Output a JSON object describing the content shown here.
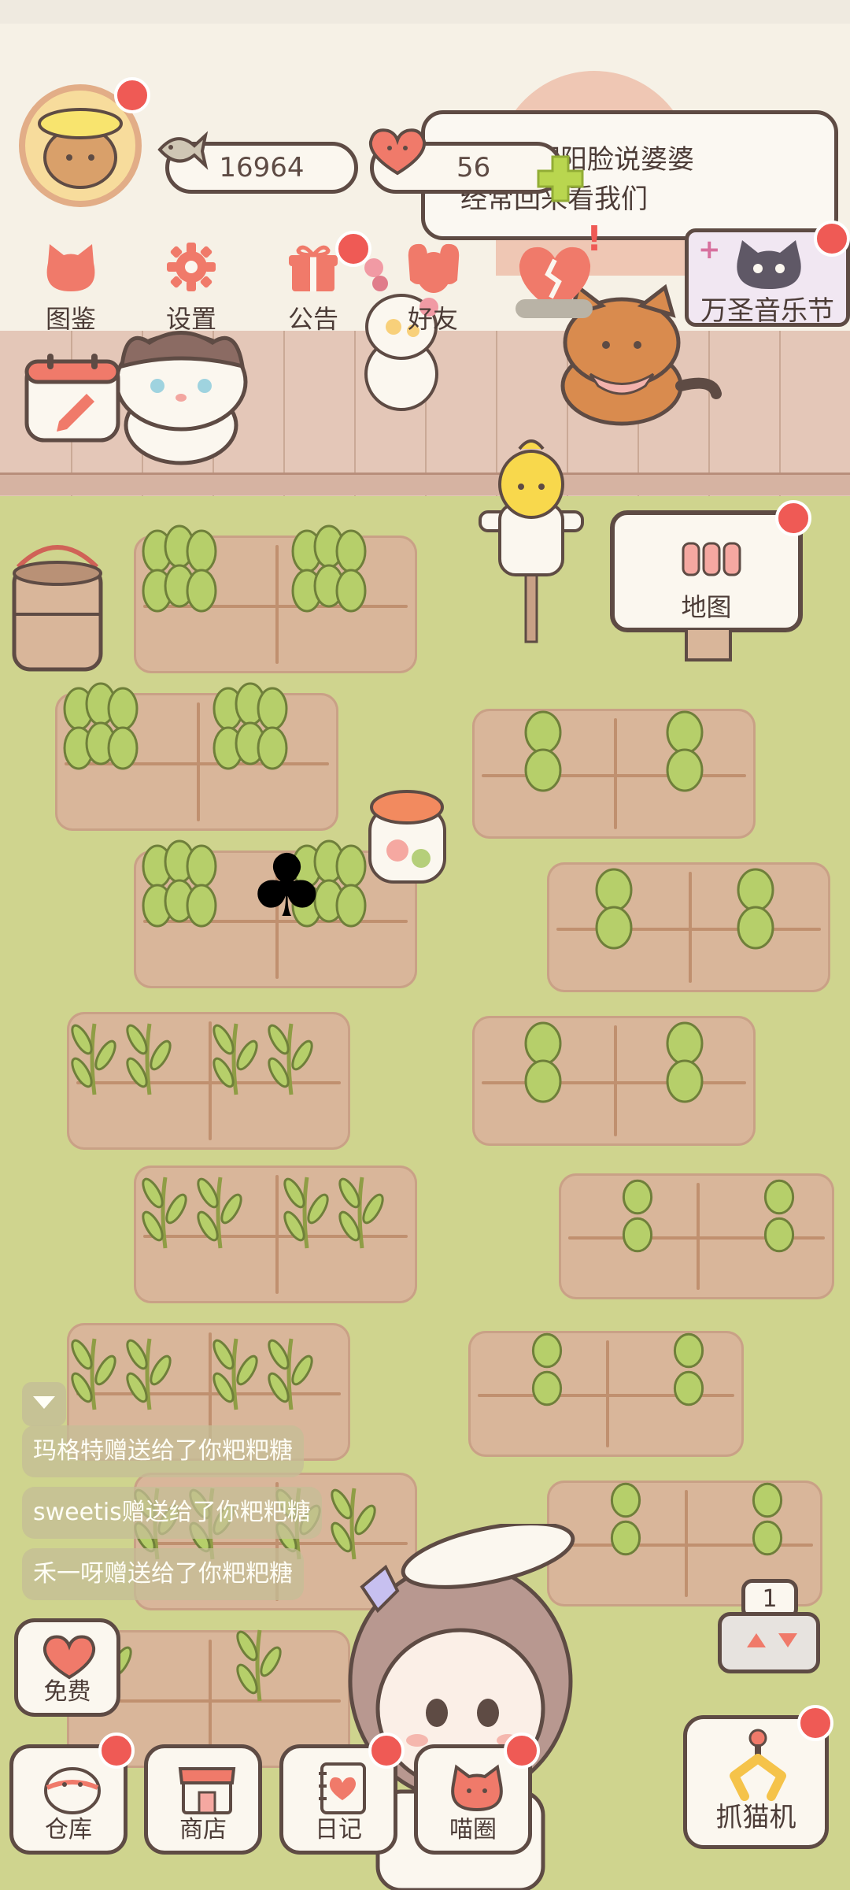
{
  "resources": {
    "fish": "16964",
    "hearts": "56"
  },
  "notice": {
    "text_line1": "了，阴阳脸说婆婆",
    "text_line2": "经常回来看我们"
  },
  "top_menu": [
    {
      "label": "图鉴",
      "icon": "cat-head-icon"
    },
    {
      "label": "设置",
      "icon": "gear-icon"
    },
    {
      "label": "公告",
      "icon": "gift-icon"
    },
    {
      "label": "好友",
      "icon": "friends-icon"
    }
  ],
  "event_banner": {
    "label": "万圣音乐节"
  },
  "map_sign": {
    "label": "地图"
  },
  "chat_messages": [
    "玛格特赠送给了你粑粑糖",
    "sweetis赠送给了你粑粑糖",
    "禾一呀赠送给了你粑粑糖"
  ],
  "free_button": {
    "label": "免费"
  },
  "elevator": {
    "floor": "1"
  },
  "bottom_menu": [
    {
      "label": "仓库",
      "icon": "storage-icon"
    },
    {
      "label": "商店",
      "icon": "shop-icon"
    },
    {
      "label": "日记",
      "icon": "diary-icon"
    },
    {
      "label": "喵圈",
      "icon": "cat-circle-icon"
    }
  ],
  "claw_machine": {
    "label": "抓猫机"
  },
  "colors": {
    "notification": "#ef5a55",
    "outline": "#5e4b44",
    "accent": "#f07a6a",
    "grass": "#cfd48e",
    "soil": "#d9b69a"
  }
}
